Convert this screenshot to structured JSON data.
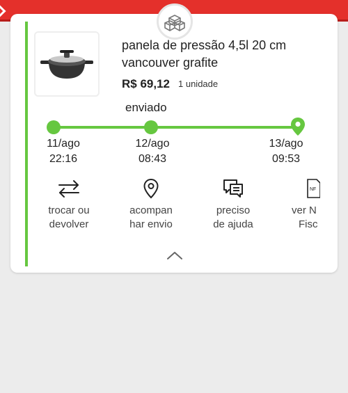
{
  "header": {
    "back_icon": "chevron-left-icon",
    "color": "#e4302b"
  },
  "badge": {
    "icon": "boxes-icon"
  },
  "product": {
    "title_line1": "panela de pressão 4,5l 20 cm",
    "title_line2": "vancouver grafite",
    "price": "R$ 69,12",
    "quantity": "1 unidade"
  },
  "tracking": {
    "status": "enviado",
    "steps": [
      {
        "date": "11/ago",
        "time": "22:16"
      },
      {
        "date": "12/ago",
        "time": "08:43"
      },
      {
        "date": "13/ago",
        "time": "09:53"
      }
    ],
    "color": "#66c740"
  },
  "actions": [
    {
      "line1": "trocar ou",
      "line2": "devolver",
      "icon": "swap-arrows-icon"
    },
    {
      "line1": "acompan",
      "line2": "har envio",
      "icon": "location-pin-icon"
    },
    {
      "line1": "preciso",
      "line2": "de ajuda",
      "icon": "chat-icon"
    },
    {
      "line1": "ver N",
      "line2": "Fisc",
      "icon": "invoice-nf-icon",
      "icon_text": "NF"
    }
  ],
  "collapse_icon": "chevron-up-icon"
}
